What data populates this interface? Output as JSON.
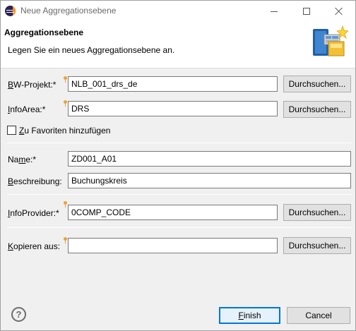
{
  "window": {
    "title": "Neue Aggregationsebene"
  },
  "header": {
    "title": "Aggregationsebene",
    "description": "Legen Sie ein neues Aggregationsebene an."
  },
  "form": {
    "bw_projekt": {
      "label_u": "B",
      "label_rest": "W-Projekt:*",
      "value": "NLB_001_drs_de"
    },
    "infoarea": {
      "label_u": "I",
      "label_rest": "nfoArea:*",
      "value": "DRS"
    },
    "favorite": {
      "label_u": "Z",
      "label_rest": "u Favoriten hinzufügen",
      "checked": false
    },
    "name": {
      "label_pre": "Na",
      "label_u": "m",
      "label_rest": "e:*",
      "value": "ZD001_A01"
    },
    "beschreibung": {
      "label_u": "B",
      "label_rest": "eschreibung:",
      "value": "Buchungskreis"
    },
    "infoprovider": {
      "label_u": "I",
      "label_rest": "nfoProvider:*",
      "value": "0COMP_CODE"
    },
    "kopieren": {
      "label_u": "K",
      "label_rest": "opieren aus:",
      "value": ""
    },
    "browse_label": "Durchsuchen..."
  },
  "footer": {
    "help_glyph": "?",
    "finish_u": "F",
    "finish_rest": "inish",
    "cancel": "Cancel"
  },
  "colors": {
    "decoration": "#e9a23b",
    "primary_border": "#0078d7"
  }
}
